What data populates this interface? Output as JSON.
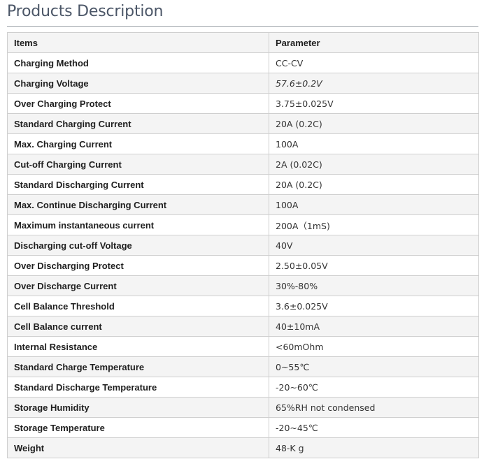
{
  "page": {
    "title": "Products Description"
  },
  "table": {
    "header": {
      "items": "Items",
      "parameter": "Parameter"
    },
    "rows": [
      {
        "item": "Charging Method",
        "value": "CC-CV"
      },
      {
        "item": "Charging Voltage",
        "value": "57.6±0.2V"
      },
      {
        "item": "Over Charging Protect",
        "value": "3.75±0.025V"
      },
      {
        "item": "Standard Charging Current",
        "value": "20A (0.2C)"
      },
      {
        "item": "Max. Charging Current",
        "value": "100A"
      },
      {
        "item": "Cut-off Charging Current",
        "value": "2A (0.02C)"
      },
      {
        "item": "Standard Discharging Current",
        "value": "20A (0.2C)"
      },
      {
        "item": "Max. Continue Discharging Current",
        "value": "100A"
      },
      {
        "item": "Maximum instantaneous current",
        "value": "200A（1mS)"
      },
      {
        "item": "Discharging cut-off Voltage",
        "value": "40V"
      },
      {
        "item": "Over Discharging Protect",
        "value": "2.50±0.05V"
      },
      {
        "item": "Over Discharge Current",
        "value": "30%-80%"
      },
      {
        "item": "Cell Balance Threshold",
        "value": "3.6±0.025V"
      },
      {
        "item": "Cell Balance current",
        "value": "40±10mA"
      },
      {
        "item": "Internal Resistance",
        "value": "<60mOhm"
      },
      {
        "item": "Standard Charge Temperature",
        "value": "0~55℃"
      },
      {
        "item": "Standard Discharge Temperature",
        "value": "-20~60℃"
      },
      {
        "item": "Storage Humidity",
        "value": "65%RH not condensed"
      },
      {
        "item": "Storage Temperature",
        "value": "-20~45℃"
      },
      {
        "item": "Weight",
        "value": "48-K g"
      }
    ]
  }
}
